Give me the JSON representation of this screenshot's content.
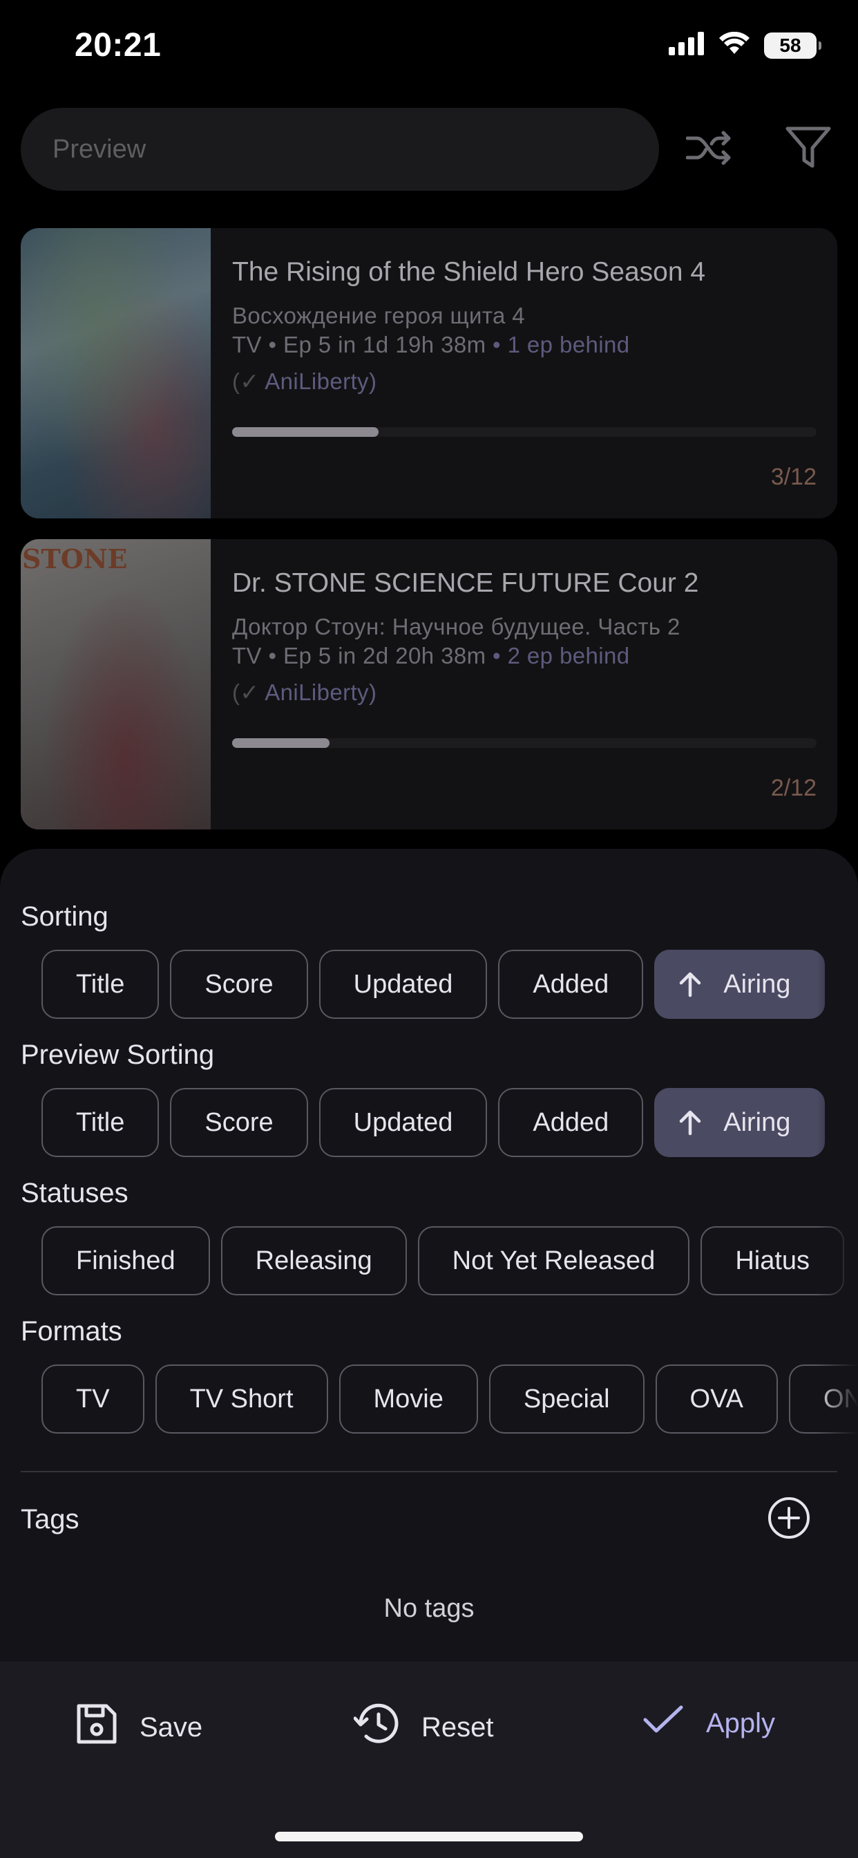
{
  "status_bar": {
    "time": "20:21",
    "battery": "58"
  },
  "search": {
    "placeholder": "Preview"
  },
  "cards": [
    {
      "title": "The Rising of the Shield Hero Season 4",
      "alt_title": "Восхождение героя щита 4",
      "info": "TV • Ep 5 in 1d 19h 38m",
      "behind": "• 1 ep behind",
      "source_open": "(",
      "source_check": "✓",
      "source_name": "AniLiberty)",
      "progress": 0.25,
      "count": "3/12"
    },
    {
      "title": "Dr. STONE SCIENCE FUTURE Cour 2",
      "alt_title": "Доктор Стоун: Научное будущее. Часть 2",
      "info": "TV • Ep 5 in 2d 20h 38m",
      "behind": "• 2 ep behind",
      "source_open": "(",
      "source_check": "✓",
      "source_name": "AniLiberty)",
      "progress": 0.167,
      "count": "2/12",
      "poster_text": "STONE"
    }
  ],
  "sheet": {
    "sorting": {
      "label": "Sorting",
      "chips": [
        "Title",
        "Score",
        "Updated",
        "Added",
        "Airing"
      ],
      "active": "Airing"
    },
    "preview_sorting": {
      "label": "Preview Sorting",
      "chips": [
        "Title",
        "Score",
        "Updated",
        "Added",
        "Airing"
      ],
      "active": "Airing"
    },
    "statuses": {
      "label": "Statuses",
      "chips": [
        "Finished",
        "Releasing",
        "Not Yet Released",
        "Hiatus"
      ]
    },
    "formats": {
      "label": "Formats",
      "chips": [
        "TV",
        "TV Short",
        "Movie",
        "Special",
        "OVA",
        "ONA"
      ]
    },
    "tags": {
      "label": "Tags",
      "empty": "No tags"
    }
  },
  "actions": {
    "save": "Save",
    "reset": "Reset",
    "apply": "Apply"
  },
  "colors": {
    "accent": "#b5b3ee",
    "active_chip": "#4b4a63",
    "sheet_bg": "#141418"
  }
}
